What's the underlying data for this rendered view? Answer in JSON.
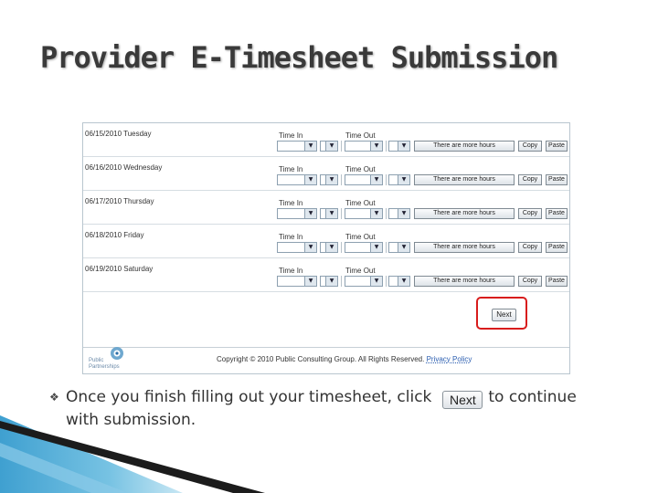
{
  "slide": {
    "title": "Provider E-Timesheet Submission",
    "bullet_text_1": "Once you finish filling out your timesheet, click",
    "bullet_text_2": "to continue with submission.",
    "inline_button_label": "Next"
  },
  "timesheet": {
    "time_in_label": "Time In",
    "time_out_label": "Time Out",
    "more_hours_label": "There are more hours",
    "copy_label": "Copy",
    "paste_label": "Paste",
    "days": [
      {
        "label": "06/15/2010 Tuesday"
      },
      {
        "label": "06/16/2010 Wednesday"
      },
      {
        "label": "06/17/2010 Thursday"
      },
      {
        "label": "06/18/2010 Friday"
      },
      {
        "label": "06/19/2010 Saturday"
      }
    ],
    "next_label": "Next"
  },
  "footer": {
    "logo_text_line1": "Public",
    "logo_text_line2": "Partnerships",
    "copyright": "Copyright © 2010 Public Consulting Group. All Rights Reserved.",
    "privacy": "Privacy Policy"
  },
  "colors": {
    "highlight": "#d81c1c",
    "accent_blue": "#1d8fc8"
  }
}
